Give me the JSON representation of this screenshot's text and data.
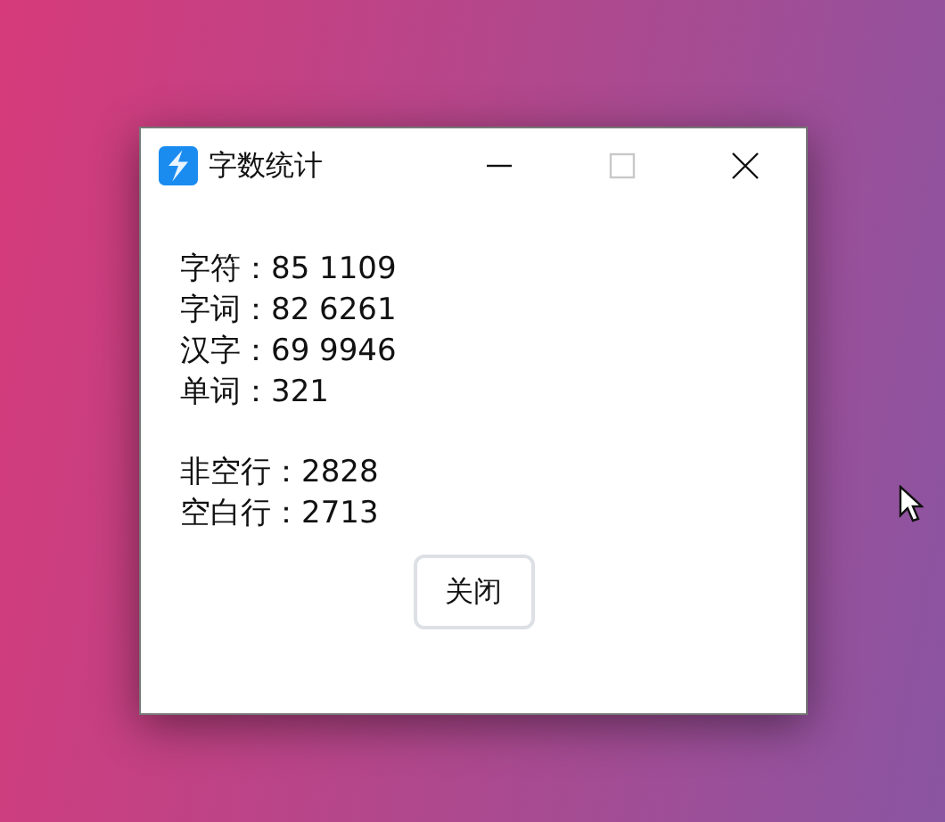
{
  "window": {
    "title": "字数统计",
    "controls": [
      {
        "kind": "minimize",
        "disabled": false
      },
      {
        "kind": "maximize",
        "disabled": true
      },
      {
        "kind": "close",
        "disabled": false
      }
    ]
  },
  "stat_groups": [
    [
      "字符：85 1109",
      "字词：82 6261",
      "汉字：69 9946",
      "单词：321"
    ],
    [
      "非空行：2828",
      "空白行：2713"
    ]
  ],
  "buttons": [
    "关闭"
  ]
}
